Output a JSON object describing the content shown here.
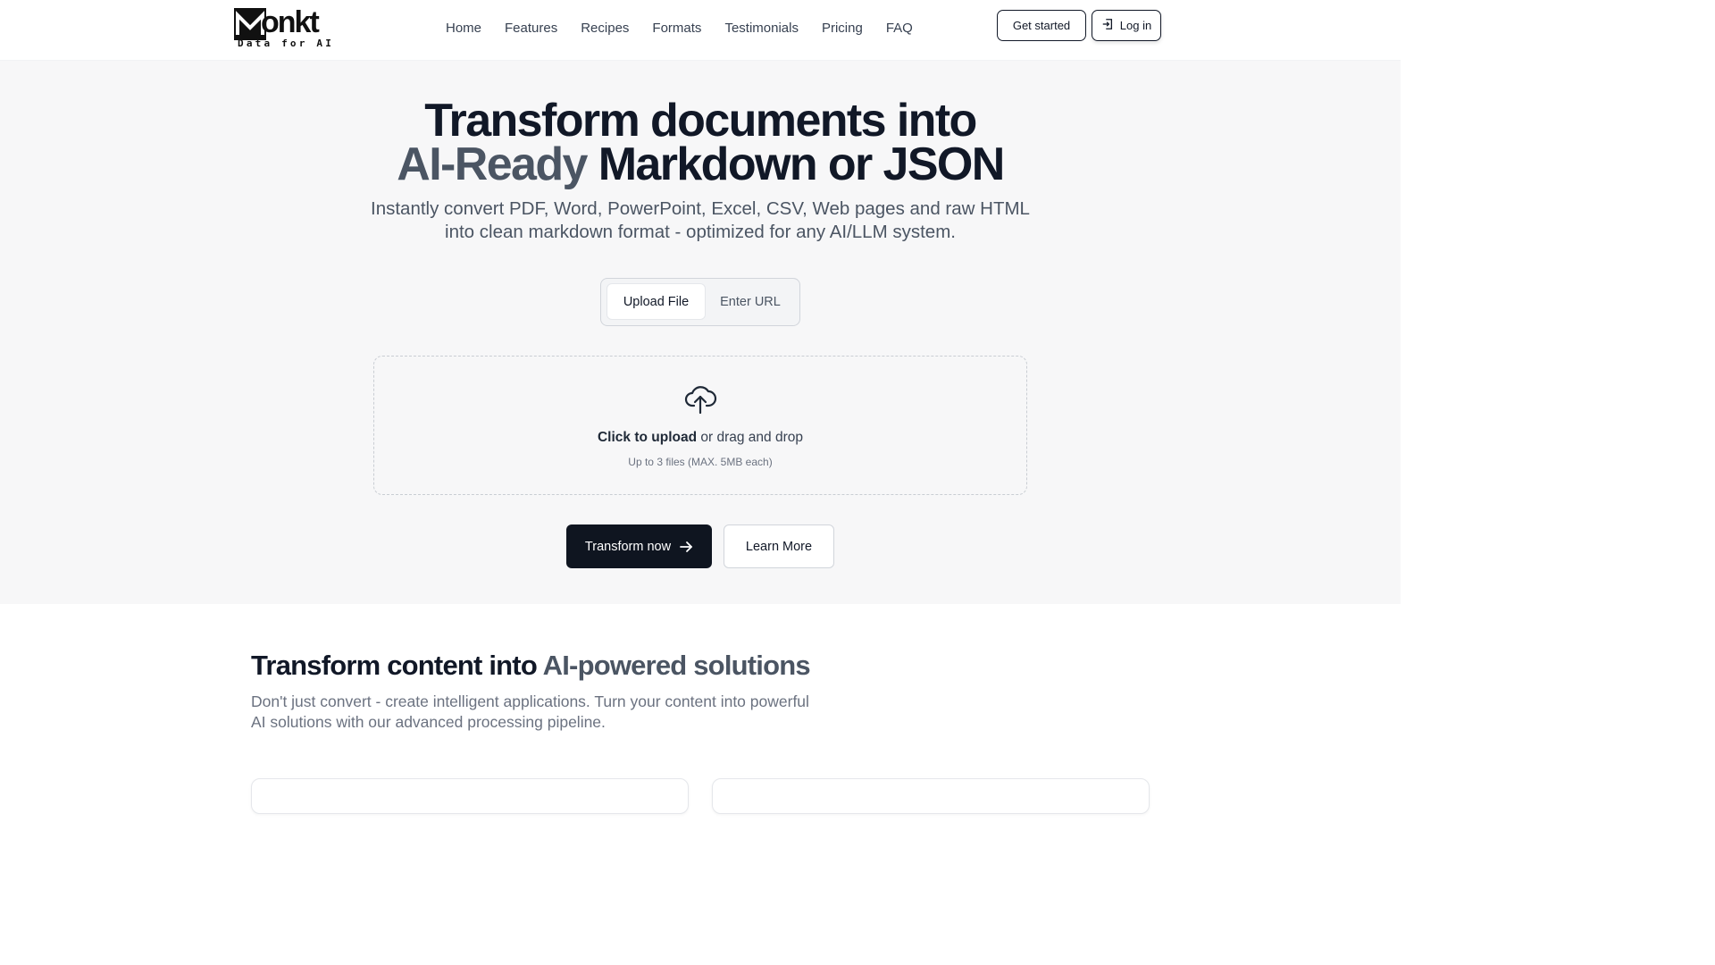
{
  "brand": {
    "name": "onkt",
    "tagline": "Data for AI"
  },
  "nav": {
    "items": [
      "Home",
      "Features",
      "Recipes",
      "Formats",
      "Testimonials",
      "Pricing",
      "FAQ"
    ]
  },
  "header_actions": {
    "get_started": "Get started",
    "login": "Log in"
  },
  "hero": {
    "title_line1": "Transform documents into",
    "title_accent": "AI-Ready",
    "title_line2_rest": " Markdown or JSON",
    "subtitle_line1": "Instantly convert PDF, Word, PowerPoint, Excel, CSV, Web pages and raw HTML",
    "subtitle_line2": "into clean markdown format - optimized for any AI/LLM system.",
    "tabs": [
      "Upload File",
      "Enter URL"
    ],
    "active_tab": "Upload File",
    "dropzone": {
      "action": "Click to upload",
      "action_rest": " or drag and drop",
      "hint": "Up to 3 files (MAX. 5MB each)"
    },
    "primary_button": "Transform now",
    "secondary_button": "Learn More"
  },
  "section2": {
    "title_start": "Transform content into ",
    "title_accent": "AI-powered solutions",
    "desc_line1": "Don't just convert - create intelligent applications. Turn your content into powerful",
    "desc_line2": "AI solutions with our advanced processing pipeline."
  },
  "colors": {
    "primary_dark": "#0f1520",
    "accent_gray": "#4b5563",
    "hero_bg": "#f7f7f8"
  },
  "icons": {
    "login": "login-icon",
    "upload": "cloud-upload-icon",
    "arrow": "arrow-right-icon"
  }
}
